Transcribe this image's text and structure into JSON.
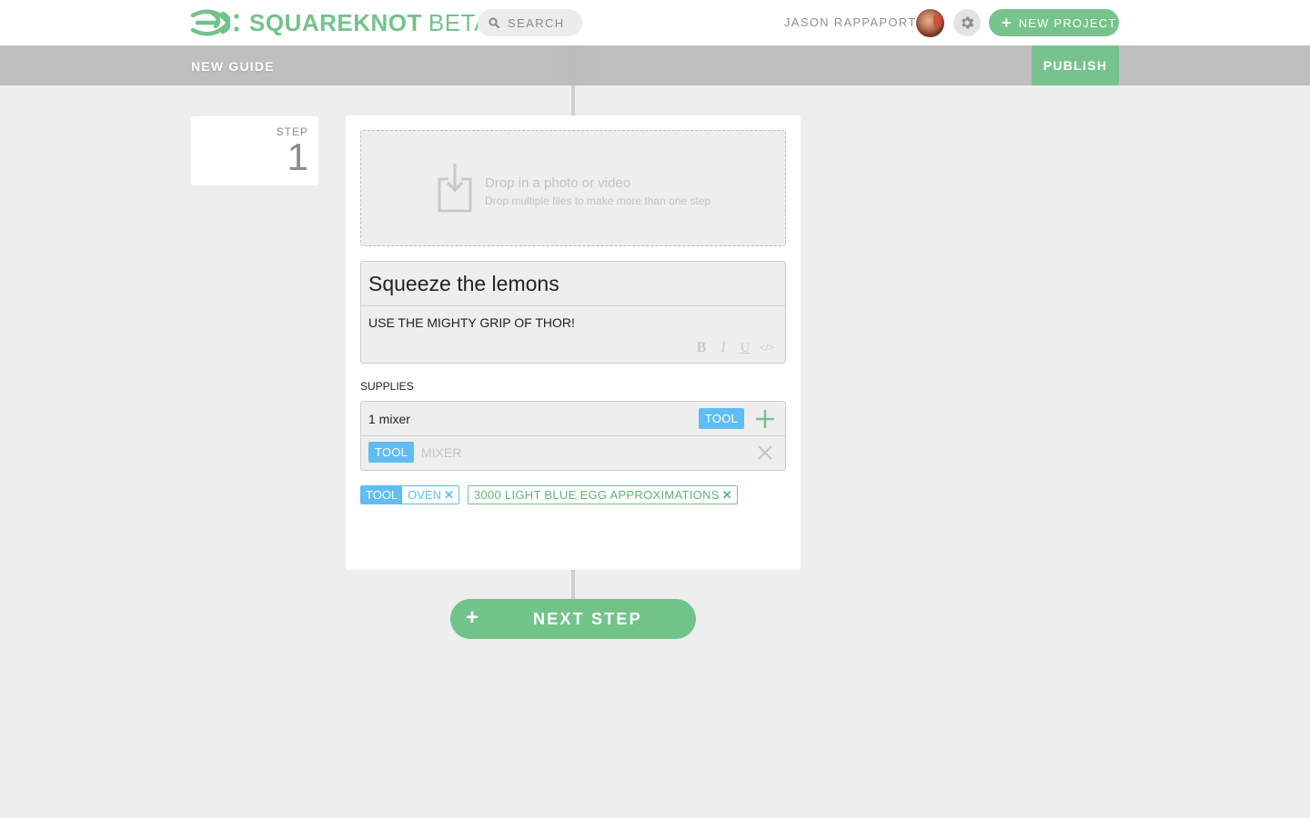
{
  "header": {
    "brand": "SQUAREKNOT",
    "brand_suffix": "BETA",
    "search_placeholder": "SEARCH",
    "user_name": "JASON RAPPAPORT",
    "new_project_label": "NEW PROJECT"
  },
  "subbar": {
    "title": "NEW GUIDE",
    "publish_label": "PUBLISH"
  },
  "step": {
    "label": "STEP",
    "number": "1"
  },
  "dropzone": {
    "title": "Drop in a photo or video",
    "subtitle": "Drop multiple files to make more than one step"
  },
  "editor": {
    "title_value": "Squeeze the lemons",
    "description": "USE THE MIGHTY GRIP OF THOR!",
    "format_buttons": [
      "B",
      "I",
      "U",
      "</>"
    ]
  },
  "supplies": {
    "label": "SUPPLIES",
    "input_value": "1 mixer",
    "input_type_chip": "TOOL",
    "suggestion_type_chip": "TOOL",
    "suggestion_text": "MIXER",
    "tags": [
      {
        "type": "TOOL",
        "name": "OVEN"
      },
      {
        "name": "3000 LIGHT BLUE EGG APPROXIMATIONS"
      }
    ]
  },
  "next_step_label": "NEXT STEP",
  "colors": {
    "brand_green": "#76c38d",
    "tool_blue": "#5fbdf3",
    "subbar_gray": "#bfbfbf",
    "background": "#eeeeee"
  }
}
